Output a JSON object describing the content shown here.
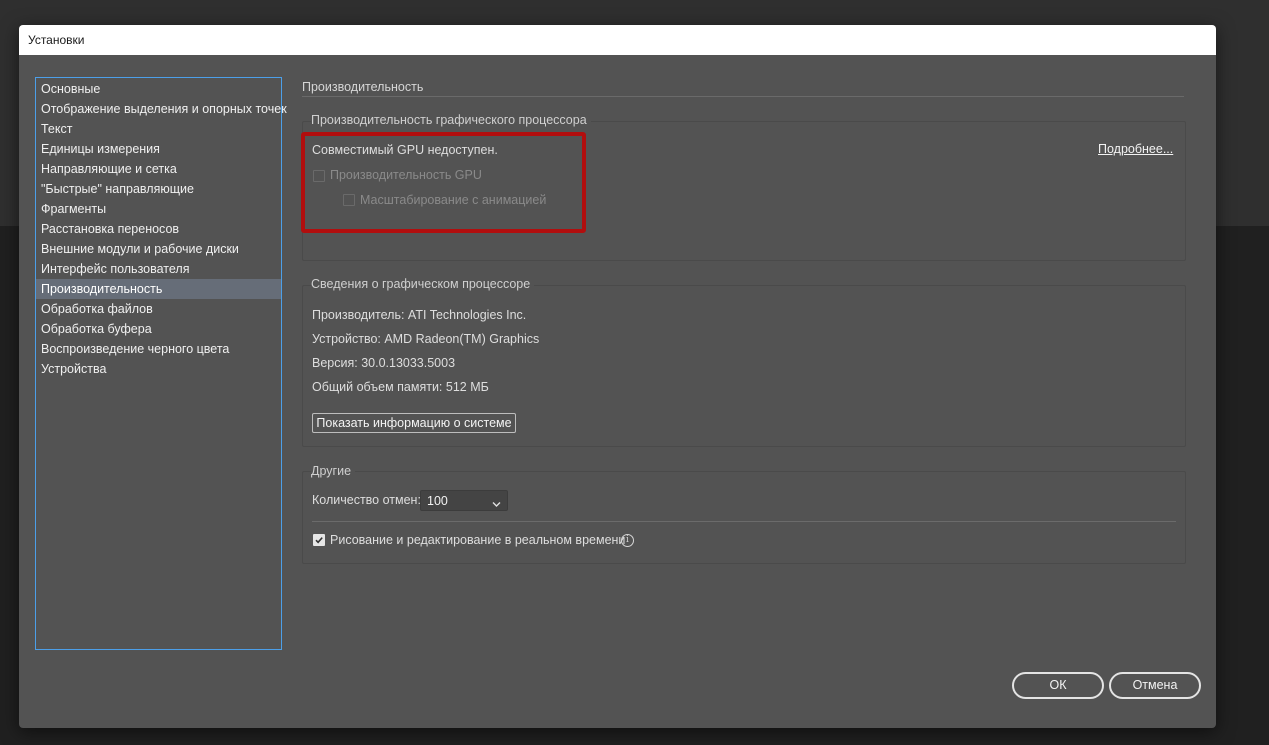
{
  "dialog": {
    "title": "Установки"
  },
  "sidebar": {
    "items": [
      {
        "label": "Основные"
      },
      {
        "label": "Отображение выделения и опорных точек"
      },
      {
        "label": "Текст"
      },
      {
        "label": "Единицы измерения"
      },
      {
        "label": "Направляющие и сетка"
      },
      {
        "label": "\"Быстрые\" направляющие"
      },
      {
        "label": "Фрагменты"
      },
      {
        "label": "Расстановка переносов"
      },
      {
        "label": "Внешние модули и рабочие диски"
      },
      {
        "label": "Интерфейс пользователя"
      },
      {
        "label": "Производительность"
      },
      {
        "label": "Обработка файлов"
      },
      {
        "label": "Обработка буфера"
      },
      {
        "label": "Воспроизведение черного цвета"
      },
      {
        "label": "Устройства"
      }
    ],
    "selected_index": 10
  },
  "main": {
    "section_title": "Производительность",
    "gpu_performance": {
      "label": "Производительность графического процессора",
      "status_text": "Совместимый GPU недоступен.",
      "more_link": "Подробнее...",
      "gpu_checkbox_label": "Производительность GPU",
      "gpu_checkbox_checked": false,
      "animated_zoom_label": "Масштабирование с анимацией",
      "animated_zoom_checked": false,
      "highlight_color": "#b10e0e"
    },
    "gpu_info": {
      "label": "Сведения о графическом процессоре",
      "vendor": "Производитель: ATI Technologies Inc.",
      "device": "Устройство: AMD Radeon(TM) Graphics",
      "version": "Версия: 30.0.13033.5003",
      "memory": "Общий объем памяти: 512 МБ",
      "system_info_button": "Показать информацию о системе"
    },
    "other": {
      "label": "Другие",
      "undo_levels_label": "Количество отмен:",
      "undo_levels_value": "100",
      "realtime_label": "Рисование и редактирование в реальном времени",
      "realtime_checked": true
    }
  },
  "footer": {
    "ok_label": "ОК",
    "cancel_label": "Отмена"
  },
  "icons": {
    "info": "info-icon",
    "dropdown": "chevron-down-icon",
    "checkmark": "checkmark-icon"
  }
}
